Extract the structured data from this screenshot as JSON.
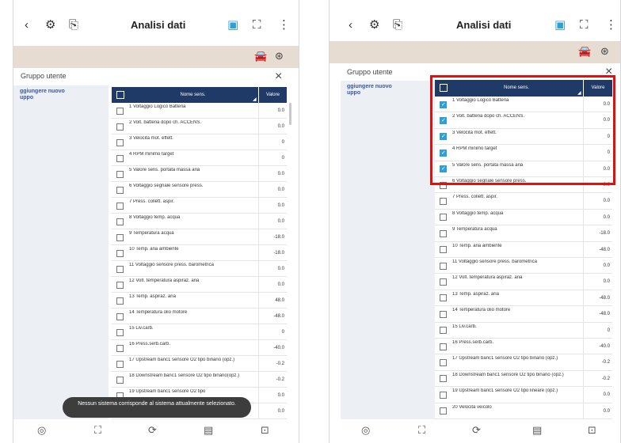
{
  "header": {
    "back": "‹",
    "title": "Analisi dati"
  },
  "group": {
    "label": "Gruppo utente",
    "close": "×",
    "add_left": "ggiungere nuovo\nuppo",
    "add_right": "ggiungere nuovo\nuppo"
  },
  "table": {
    "col_name": "Nome sens.",
    "col_value": "Valore"
  },
  "left_rows": [
    {
      "name": "1 Voltaggio Logico Batteria",
      "value": "0.0"
    },
    {
      "name": "2 Volt. batteria dopo ch. ACCENS.",
      "value": "0.0"
    },
    {
      "name": "3 Velocità mot. effett.",
      "value": "0"
    },
    {
      "name": "4 RPM minimo target",
      "value": "0"
    },
    {
      "name": "5 Valore sens. portata massa aria",
      "value": "0.0"
    },
    {
      "name": "6 Voltaggio segnale sensore press.",
      "value": "0.0"
    },
    {
      "name": "7 Press. collett. aspir.",
      "value": "0.0"
    },
    {
      "name": "8 Voltaggio temp. acqua",
      "value": "0.0"
    },
    {
      "name": "9 Temperatura acqua",
      "value": "-18.0"
    },
    {
      "name": "10 Temp. aria ambiente",
      "value": "-18.0"
    },
    {
      "name": "11 Voltaggio sensore press. barometrica",
      "value": "0.0"
    },
    {
      "name": "12 Volt. temperatura aspiraz. aria",
      "value": "0.0"
    },
    {
      "name": "13 Temp. aspiraz. aria",
      "value": "48.0"
    },
    {
      "name": "14 Temperatura olio motore",
      "value": "-48.0"
    },
    {
      "name": "15 Liv.carb.",
      "value": "0"
    },
    {
      "name": "16 Press.serb.carb.",
      "value": "-40.0"
    },
    {
      "name": "17 Upstream banc1 sensore O2 tipo binario (opz.)",
      "value": "-0.2"
    },
    {
      "name": "18 Downstream banc1 sensore O2 tipo binario(opz.)",
      "value": "-0.2"
    },
    {
      "name": "19 Upstream banc1 sensore O2 tipo",
      "value": "0.0"
    },
    {
      "name": "",
      "value": "0.0"
    }
  ],
  "right_rows": [
    {
      "name": "1 Voltaggio Logico Batteria",
      "value": "0.0",
      "checked": true
    },
    {
      "name": "2 Volt. batteria dopo ch. ACCENS.",
      "value": "0.0",
      "checked": true
    },
    {
      "name": "3 Velocità mot. effett.",
      "value": "0",
      "checked": true
    },
    {
      "name": "4 RPM minimo target",
      "value": "0",
      "checked": true
    },
    {
      "name": "5 Valore sens. portata massa aria",
      "value": "0.0",
      "checked": true
    },
    {
      "name": "6 Voltaggio segnale sensore press.",
      "value": "0.0",
      "checked": false
    },
    {
      "name": "7 Press. collett. aspir.",
      "value": "0.0",
      "checked": false
    },
    {
      "name": "8 Voltaggio temp. acqua",
      "value": "0.0",
      "checked": false
    },
    {
      "name": "9 Temperatura acqua",
      "value": "-18.0",
      "checked": false
    },
    {
      "name": "10 Temp. aria ambiente",
      "value": "-48.0",
      "checked": false
    },
    {
      "name": "11 Voltaggio sensore press. barometrica",
      "value": "0.0",
      "checked": false
    },
    {
      "name": "12 Volt. temperatura aspiraz. aria",
      "value": "0.0",
      "checked": false
    },
    {
      "name": "13 Temp. aspiraz. aria",
      "value": "-48.0",
      "checked": false
    },
    {
      "name": "14 Temperatura olio motore",
      "value": "-48.0",
      "checked": false
    },
    {
      "name": "15 Liv.carb.",
      "value": "0",
      "checked": false
    },
    {
      "name": "16 Press.serb.carb.",
      "value": "-40.0",
      "checked": false
    },
    {
      "name": "17 Upstream banc1 sensore O2 tipo binario (opz.)",
      "value": "-0.2",
      "checked": false
    },
    {
      "name": "18 Downstream banc1 sensore O2 tipo binario (opz.)",
      "value": "-0.2",
      "checked": false
    },
    {
      "name": "19 Upstream banc1 sensore O2 tipo lineare (opz.)",
      "value": "0.0",
      "checked": false
    },
    {
      "name": "20 Velocità veicolo",
      "value": "0.0",
      "checked": false
    }
  ],
  "toast": "Nessun sistema corrisponde al sistema attualmente selezionato.",
  "icons": {
    "engine": "engine-icon",
    "device": "device-icon",
    "badge": "badge-icon",
    "expand": "expand-icon",
    "menu": "menu-icon",
    "car": "car-icon",
    "dial": "dial-icon",
    "home": "home-icon",
    "refresh": "refresh-icon",
    "doc": "doc-icon",
    "save": "save-icon"
  },
  "colors": {
    "header_bg": "#1f3a66",
    "check": "#2f9fd8",
    "highlight": "#e01010",
    "beige": "#e6dcd2"
  }
}
